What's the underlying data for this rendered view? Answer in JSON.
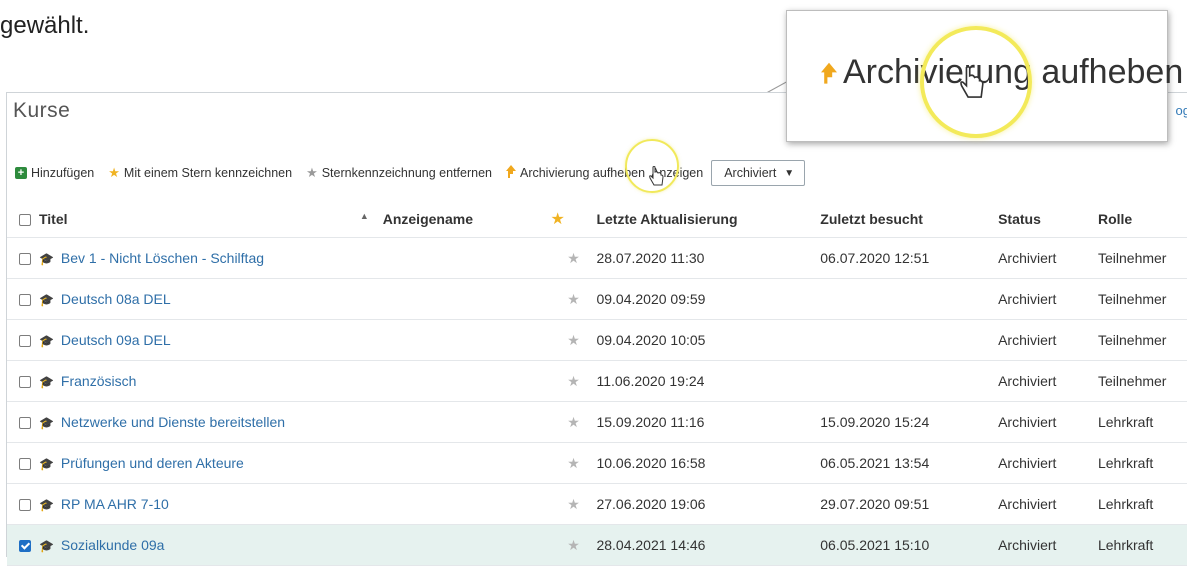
{
  "intro_text": "gewählt.",
  "panel": {
    "title": "Kurse",
    "right_cut_text": "og"
  },
  "toolbar": {
    "add_label": "Hinzufügen",
    "star_label": "Mit einem Stern kennzeichnen",
    "unstar_label": "Sternkennzeichnung entfernen",
    "unarchive_label": "Archivierung aufheben",
    "show_label": "Anzeigen",
    "filter_value": "Archiviert"
  },
  "zoom": {
    "label": "Archivierung aufheben"
  },
  "columns": {
    "title": "Titel",
    "display_name": "Anzeigename",
    "last_update": "Letzte Aktualisierung",
    "last_visit": "Zuletzt besucht",
    "status": "Status",
    "role": "Rolle"
  },
  "rows": [
    {
      "title": "Bev 1 - Nicht Löschen - Schilftag",
      "updated": "28.07.2020 11:30",
      "visited": "06.07.2020 12:51",
      "status": "Archiviert",
      "role": "Teilnehmer",
      "checked": false
    },
    {
      "title": "Deutsch 08a DEL",
      "updated": "09.04.2020 09:59",
      "visited": "",
      "status": "Archiviert",
      "role": "Teilnehmer",
      "checked": false
    },
    {
      "title": "Deutsch 09a DEL",
      "updated": "09.04.2020 10:05",
      "visited": "",
      "status": "Archiviert",
      "role": "Teilnehmer",
      "checked": false
    },
    {
      "title": "Französisch",
      "updated": "11.06.2020 19:24",
      "visited": "",
      "status": "Archiviert",
      "role": "Teilnehmer",
      "checked": false
    },
    {
      "title": "Netzwerke und Dienste bereitstellen",
      "updated": "15.09.2020 11:16",
      "visited": "15.09.2020 15:24",
      "status": "Archiviert",
      "role": "Lehrkraft",
      "checked": false
    },
    {
      "title": "Prüfungen und deren Akteure",
      "updated": "10.06.2020 16:58",
      "visited": "06.05.2021 13:54",
      "status": "Archiviert",
      "role": "Lehrkraft",
      "checked": false
    },
    {
      "title": "RP MA AHR 7-10",
      "updated": "27.06.2020 19:06",
      "visited": "29.07.2020 09:51",
      "status": "Archiviert",
      "role": "Lehrkraft",
      "checked": false
    },
    {
      "title": "Sozialkunde 09a",
      "updated": "28.04.2021 14:46",
      "visited": "06.05.2021 15:10",
      "status": "Archiviert",
      "role": "Lehrkraft",
      "checked": true
    }
  ],
  "icons": {
    "add": "plus-square-icon",
    "star": "star-icon",
    "unarchive": "arrow-up-icon",
    "course": "graduation-cap-icon",
    "cursor": "hand-pointer-icon"
  },
  "colors": {
    "accent_link": "#2f6fa8",
    "add_green": "#2e8b3d",
    "star_gold": "#f0b323",
    "selected_row": "#e6f2ef",
    "highlight_yellow": "#f3ea5a"
  }
}
